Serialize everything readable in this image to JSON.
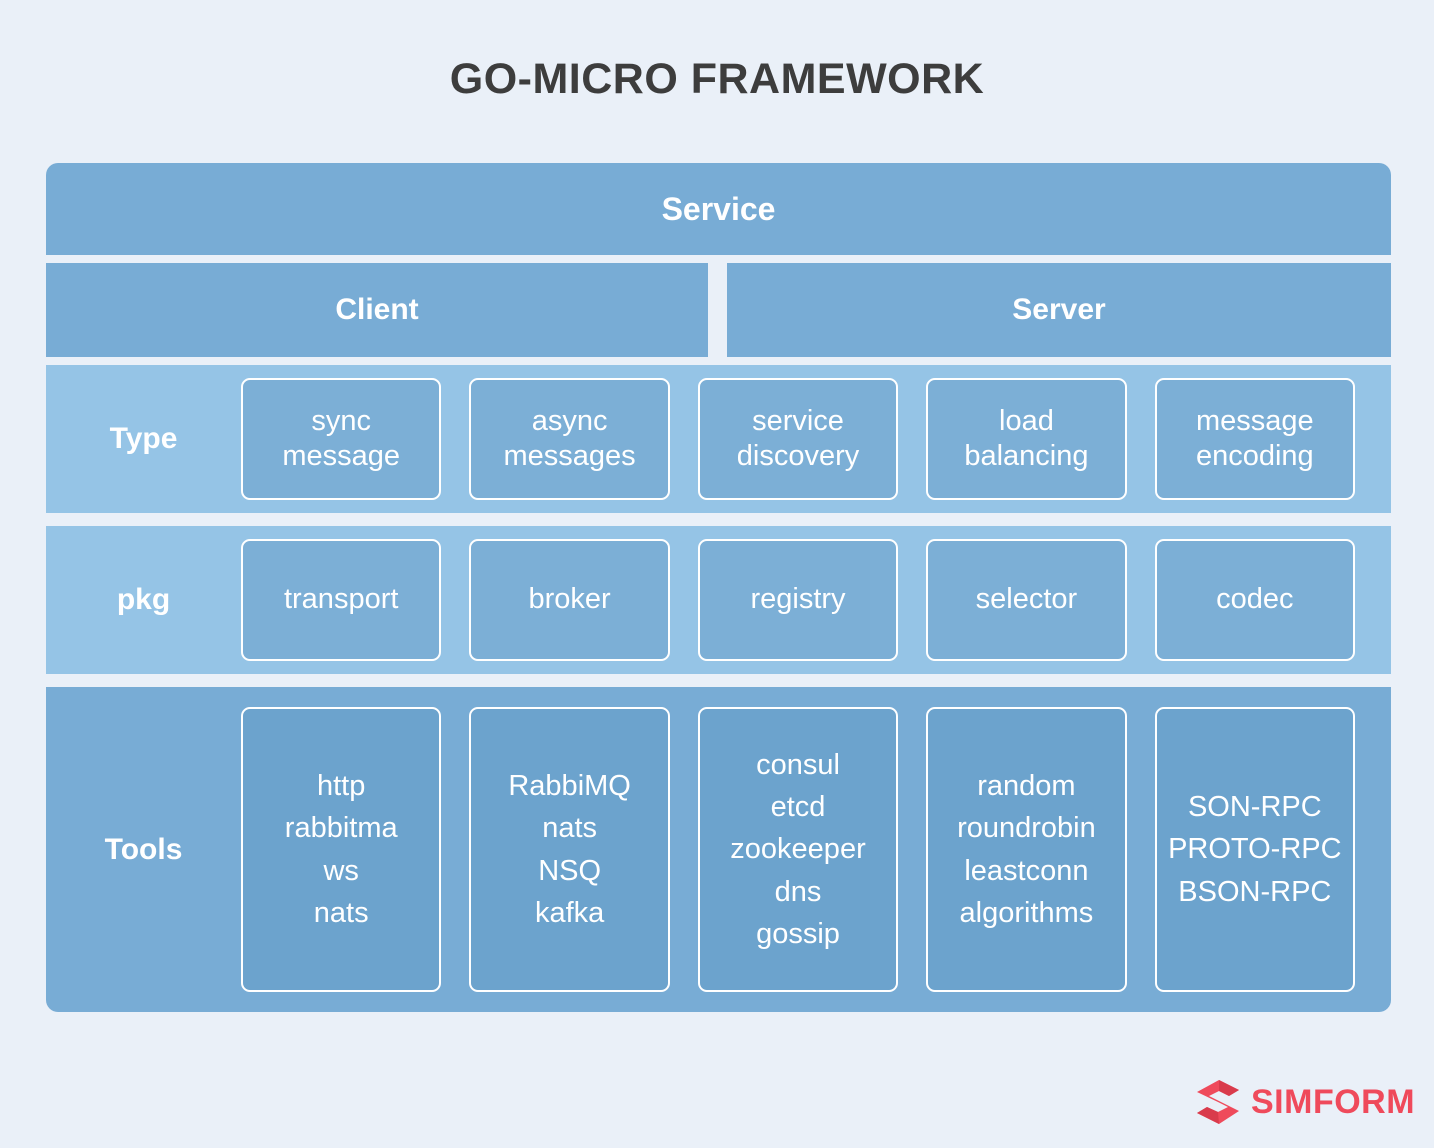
{
  "title": "GO-MICRO FRAMEWORK",
  "colors": {
    "page_background": "#eaf0f8",
    "bar_blue": "#78acd5",
    "layer_light_blue": "#95c4e6",
    "box_blue": "#7cafd6",
    "tools_box_blue": "#6ca3cd",
    "title_gray": "#3d3d3d",
    "brand_red": "#ef4a5b"
  },
  "diagram": {
    "service": {
      "label": "Service"
    },
    "tiers": [
      {
        "label": "Client"
      },
      {
        "label": "Server"
      }
    ],
    "rows": [
      {
        "label": "Type",
        "cells": [
          "sync\nmessage",
          "async\nmessages",
          "service\ndiscovery",
          "load\nbalancing",
          "message\nencoding"
        ]
      },
      {
        "label": "pkg",
        "cells": [
          "transport",
          "broker",
          "registry",
          "selector",
          "codec"
        ]
      },
      {
        "label": "Tools",
        "cells": [
          "http\nrabbitma\nws\nnats",
          "RabbiMQ\nnats\nNSQ\nkafka",
          "consul\netcd\nzookeeper\ndns\ngossip",
          "random\nroundrobin\nleastconn\nalgorithms",
          "SON-RPC\nPROTO-RPC\nBSON-RPC"
        ]
      }
    ]
  },
  "logo": {
    "text": "SIMFORM",
    "mark": "simform-diamond-icon"
  }
}
